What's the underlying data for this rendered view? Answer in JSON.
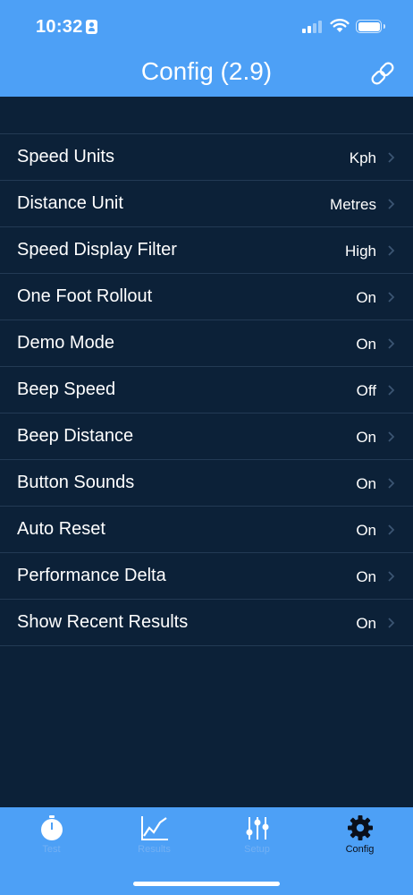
{
  "status_bar": {
    "time": "10:32"
  },
  "nav": {
    "title": "Config (2.9)",
    "link_icon": "link-icon"
  },
  "settings": [
    {
      "label": "Speed Units",
      "value": "Kph"
    },
    {
      "label": "Distance Unit",
      "value": "Metres"
    },
    {
      "label": "Speed Display Filter",
      "value": "High"
    },
    {
      "label": "One Foot Rollout",
      "value": "On"
    },
    {
      "label": "Demo Mode",
      "value": "On"
    },
    {
      "label": "Beep Speed",
      "value": "Off"
    },
    {
      "label": "Beep Distance",
      "value": "On"
    },
    {
      "label": "Button Sounds",
      "value": "On"
    },
    {
      "label": "Auto Reset",
      "value": "On"
    },
    {
      "label": "Performance Delta",
      "value": "On"
    },
    {
      "label": "Show Recent Results",
      "value": "On"
    }
  ],
  "tabs": [
    {
      "label": "Test",
      "icon": "stopwatch-icon",
      "active": false
    },
    {
      "label": "Results",
      "icon": "chart-icon",
      "active": false
    },
    {
      "label": "Setup",
      "icon": "sliders-icon",
      "active": false
    },
    {
      "label": "Config",
      "icon": "gear-icon",
      "active": true
    }
  ],
  "colors": {
    "header": "#4da0f6",
    "background": "#0c2138",
    "separator": "#233a54"
  }
}
